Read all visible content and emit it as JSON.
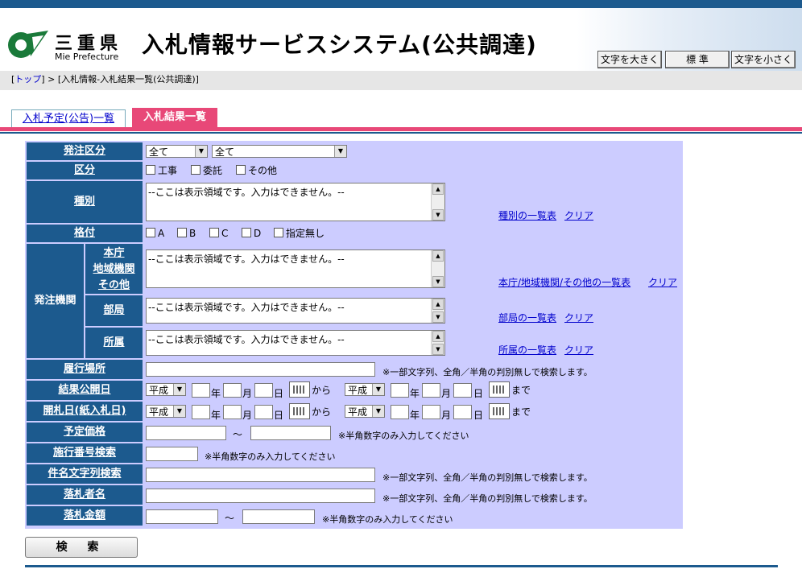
{
  "header": {
    "pref_name_jp": "三重県",
    "pref_name_en": "Mie Prefecture",
    "site_title": "入札情報サービスシステム(公共調達)",
    "font_buttons": {
      "larger": "文字を大きく",
      "standard": "標 準",
      "smaller": "文字を小さく"
    }
  },
  "breadcrumb": {
    "top_link": "トップ",
    "open": "[",
    "close": "]",
    "separator": " > ",
    "current": "[入札情報-入札結果一覧(公共調達)]"
  },
  "tabs": [
    {
      "label": "入札予定(公告)一覧",
      "active": false
    },
    {
      "label": "入札結果一覧",
      "active": true
    }
  ],
  "form": {
    "order_division": {
      "label": "発注区分",
      "select1": "全て",
      "select2": "全て"
    },
    "category": {
      "label": "区分",
      "options": [
        "工事",
        "委託",
        "その他"
      ]
    },
    "type": {
      "label": "種別",
      "display": "--ここは表示領域です。入力はできません。--",
      "list_link": "種別の一覧表",
      "clear": "クリア"
    },
    "grade": {
      "label": "格付",
      "options": [
        "A",
        "B",
        "C",
        "D",
        "指定無し"
      ]
    },
    "agency": {
      "label": "発注機関",
      "sub1_lines": [
        "本庁",
        "地域機関",
        "その他"
      ],
      "sub1_display": "--ここは表示領域です。入力はできません。--",
      "sub1_link": "本庁/地域機関/その他の一覧表",
      "sub2": "部局",
      "sub2_display": "--ここは表示領域です。入力はできません。--",
      "sub2_link": "部局の一覧表",
      "sub3": "所属",
      "sub3_display": "--ここは表示領域です。入力はできません。--",
      "sub3_link": "所属の一覧表",
      "clear": "クリア"
    },
    "place": {
      "label": "履行場所",
      "note": "※一部文字列、全角／半角の判別無しで検索します。"
    },
    "result_date": {
      "label": "結果公開日"
    },
    "open_date": {
      "label": "開札日(紙入札日)"
    },
    "date_words": {
      "era": "平成",
      "year": "年",
      "month": "月",
      "day": "日",
      "from": "から",
      "to": "まで"
    },
    "est_price": {
      "label": "予定価格",
      "tilde": "〜",
      "note": "※半角数字のみ入力してください"
    },
    "exec_number": {
      "label": "施行番号検索",
      "note": "※半角数字のみ入力してください"
    },
    "subject": {
      "label": "件名文字列検索",
      "note": "※一部文字列、全角／半角の判別無しで検索します。"
    },
    "winner": {
      "label": "落札者名",
      "note": "※一部文字列、全角／半角の判別無しで検索します。"
    },
    "amount": {
      "label": "落札金額",
      "tilde": "〜",
      "note": "※半角数字のみ入力してください"
    }
  },
  "search_button": "検 索",
  "colors": {
    "header_blue": "#1c5a8e",
    "form_bg": "#ccccff",
    "tab_pink": "#e84878",
    "link": "#0000cc"
  }
}
